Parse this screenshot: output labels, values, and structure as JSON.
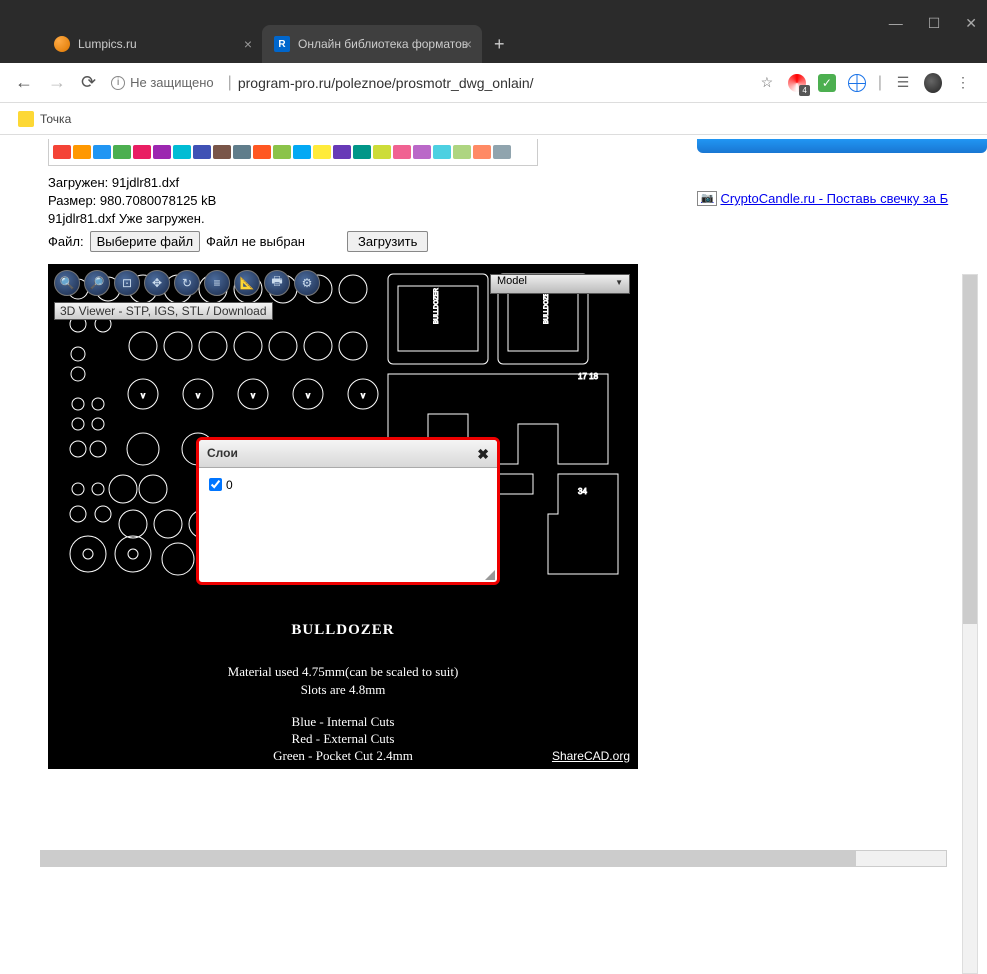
{
  "window": {
    "minimize": "—",
    "maximize": "☐",
    "close": "✕"
  },
  "tabs": [
    {
      "title": "Lumpics.ru",
      "active": false
    },
    {
      "title": "Онлайн библиотека форматов",
      "active": true
    }
  ],
  "new_tab": "+",
  "nav": {
    "back": "←",
    "forward": "→",
    "reload": "⟳"
  },
  "security": {
    "icon": "i",
    "label": "Не защищено"
  },
  "url": "program-pro.ru/poleznoe/prosmotr_dwg_onlain/",
  "bookmarks": {
    "item1": "Точка"
  },
  "file_info": {
    "loaded_label": "Загружен:",
    "loaded_file": "91jdlr81.dxf",
    "size_label": "Размер:",
    "size_value": "980.7080078125 kB",
    "already_loaded": "91jdlr81.dxf Уже загружен.",
    "file_label": "Файл:",
    "choose_btn": "Выберите файл",
    "no_file": "Файл не выбран",
    "upload_btn": "Загрузить"
  },
  "sidebar": {
    "crypto_alt": "📷",
    "crypto_text": "CryptoCandle.ru - Поставь свечку за Б"
  },
  "viewer": {
    "model_select": "Model",
    "links_text": "3D Viewer - STP, IGS, STL / Download",
    "sharecad": "ShareCAD.org",
    "title": "BULLDOZER",
    "line1": "Material used 4.75mm(can be scaled to suit)",
    "line2": "Slots are 4.8mm",
    "line3": "Blue - Internal Cuts",
    "line4": "Red - External Cuts",
    "line5": "Green - Pocket Cut 2.4mm"
  },
  "layers": {
    "title": "Слои",
    "layer0": "0"
  }
}
